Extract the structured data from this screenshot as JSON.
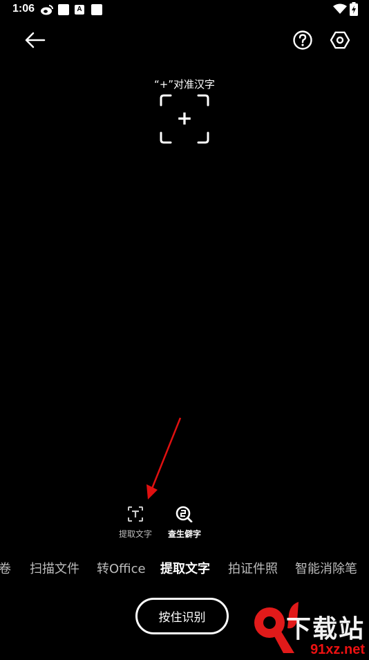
{
  "status_bar": {
    "time": "1:06",
    "a_badge": "A",
    "icons": [
      "weibo-icon",
      "notification-square-icon",
      "a-icon",
      "notification-square-icon",
      "wifi-icon",
      "battery-charging-icon"
    ]
  },
  "header": {
    "back_icon": "arrow-left-icon",
    "help_icon": "question-circle-icon",
    "settings_icon": "hexagon-settings-icon"
  },
  "viewfinder": {
    "hint": "“+”对准汉字",
    "crosshair_symbol": "+"
  },
  "tools": [
    {
      "label": "提取文字",
      "icon": "text-scan-icon",
      "active": false
    },
    {
      "label": "查生僻字",
      "icon": "search-char-icon",
      "active": true
    }
  ],
  "modes": [
    {
      "label": "卷",
      "active": false
    },
    {
      "label": "扫描文件",
      "active": false
    },
    {
      "label": "转Office",
      "active": false
    },
    {
      "label": "提取文字",
      "active": true
    },
    {
      "label": "拍证件照",
      "active": false
    },
    {
      "label": "智能消除笔",
      "active": false
    }
  ],
  "primary_action": {
    "label": "按住识别"
  },
  "watermark": {
    "text": "下载站",
    "url": "91xz.net",
    "accent_color": "#e11a1a"
  },
  "colors": {
    "background": "#000000",
    "foreground": "#ffffff",
    "inactive": "#bdbdbd",
    "annotation_arrow": "#e01010"
  }
}
